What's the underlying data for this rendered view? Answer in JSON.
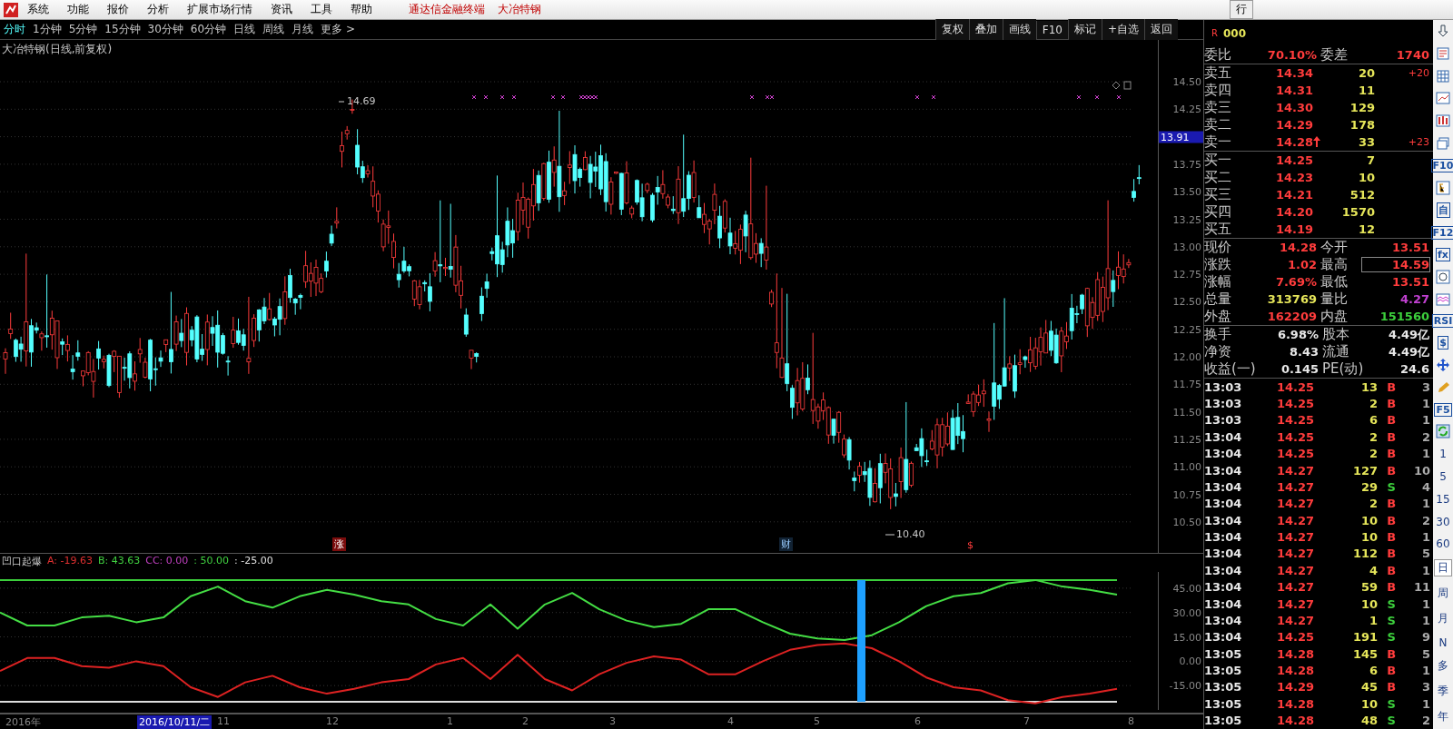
{
  "menu": [
    "系统",
    "功能",
    "报价",
    "分析",
    "扩展市场行情",
    "资讯",
    "工具",
    "帮助"
  ],
  "header_titles": [
    "通达信金融终端",
    "大冶特钢"
  ],
  "header_tab": "行",
  "period_tabs": [
    {
      "label": "分时",
      "selected": true
    },
    {
      "label": "1分钟",
      "selected": false
    },
    {
      "label": "5分钟",
      "selected": false
    },
    {
      "label": "15分钟",
      "selected": false
    },
    {
      "label": "30分钟",
      "selected": false
    },
    {
      "label": "60分钟",
      "selected": false
    },
    {
      "label": "日线",
      "selected": false
    },
    {
      "label": "周线",
      "selected": false
    },
    {
      "label": "月线",
      "selected": false
    },
    {
      "label": "更多 >",
      "selected": false
    }
  ],
  "tool_buttons": [
    "复权",
    "叠加",
    "画线",
    "F10",
    "标记",
    "+自选",
    "返回"
  ],
  "chart": {
    "title": "大冶特钢(日线,前复权)",
    "price_ticks": [
      "14.50",
      "14.25",
      "13.75",
      "13.50",
      "13.25",
      "13.00",
      "12.75",
      "12.50",
      "12.25",
      "12.00",
      "11.75",
      "11.50",
      "11.25",
      "11.00",
      "10.75",
      "10.50"
    ],
    "current_price_tag": "13.91",
    "high_label": "14.69",
    "low_label": "10.40",
    "markers": [
      {
        "text": "涨",
        "kind": "rise"
      },
      {
        "text": "财",
        "kind": "finance"
      },
      {
        "text": "$",
        "kind": "dividend"
      }
    ]
  },
  "indicator": {
    "name": "凹口起爆",
    "legend": [
      {
        "text": "A: -19.63",
        "color": "#e03030"
      },
      {
        "text": "B: 43.63",
        "color": "#40d040"
      },
      {
        "text": "CC: 0.00",
        "color": "#c040c0"
      },
      {
        "text": ": 50.00",
        "color": "#40d040"
      },
      {
        "text": ": -25.00",
        "color": "#e0e0e0"
      }
    ],
    "chart_data": {
      "type": "line",
      "ylim": [
        -30,
        55
      ],
      "grid": true,
      "yticks": [
        {
          "value": 45,
          "label": "45.00"
        },
        {
          "value": 30,
          "label": "30.00"
        },
        {
          "value": 15,
          "label": "15.00"
        },
        {
          "value": 0,
          "label": "0.00"
        },
        {
          "value": -15,
          "label": "-15.00"
        }
      ],
      "series": [
        {
          "color": "#3ccf3c",
          "values": [
            50,
            50,
            50,
            50,
            50,
            50,
            50,
            50,
            50,
            50,
            50,
            50,
            50,
            50,
            50,
            50,
            50,
            50,
            50,
            50,
            50,
            50,
            50,
            50,
            50,
            50,
            50,
            50,
            50,
            50,
            50,
            50,
            50,
            50,
            50,
            50,
            50,
            50,
            50,
            50,
            50,
            50
          ]
        },
        {
          "color": "#dddddd",
          "values": [
            -25,
            -25,
            -25,
            -25,
            -25,
            -25,
            -25,
            -25,
            -25,
            -25,
            -25,
            -25,
            -25,
            -25,
            -25,
            -25,
            -25,
            -25,
            -25,
            -25,
            -25,
            -25,
            -25,
            -25,
            -25,
            -25,
            -25,
            -25,
            -25,
            -25,
            -25,
            -25,
            -25,
            -25,
            -25,
            -25,
            -25,
            -25,
            -25,
            -25,
            -25,
            -25
          ]
        },
        {
          "color": "#44dd44",
          "values": [
            30,
            22,
            22,
            27,
            28,
            24,
            27,
            40,
            46,
            37,
            33,
            40,
            44,
            41,
            37,
            35,
            26,
            22,
            35,
            20,
            35,
            42,
            32,
            25,
            21,
            23,
            32,
            32,
            24,
            17,
            14,
            13,
            16,
            24,
            34,
            40,
            42,
            48,
            50,
            46,
            44,
            41
          ]
        },
        {
          "color": "#dd2222",
          "values": [
            -6,
            2,
            2,
            -3,
            -4,
            0,
            -3,
            -16,
            -22,
            -13,
            -9,
            -16,
            -20,
            -17,
            -13,
            -11,
            -2,
            2,
            -11,
            4,
            -11,
            -18,
            -8,
            -1,
            3,
            1,
            -8,
            -8,
            0,
            7,
            10,
            11,
            8,
            0,
            -10,
            -16,
            -18,
            -24,
            -26,
            -22,
            -20,
            -17
          ]
        }
      ]
    }
  },
  "date_axis": [
    {
      "text": "2016年",
      "selected": false
    },
    {
      "text": "2016/10/11/二",
      "selected": true
    },
    {
      "text": "11",
      "selected": false
    },
    {
      "text": "12",
      "selected": false
    },
    {
      "text": "1",
      "selected": false
    },
    {
      "text": "2",
      "selected": false
    },
    {
      "text": "3",
      "selected": false
    },
    {
      "text": "4",
      "selected": false
    },
    {
      "text": "5",
      "selected": false
    },
    {
      "text": "6",
      "selected": false
    },
    {
      "text": "7",
      "selected": false
    },
    {
      "text": "8",
      "selected": false
    }
  ],
  "quote": {
    "marker": "R",
    "code": "000",
    "ratio": {
      "label": "委比",
      "value": "70.10%",
      "label2": "委差",
      "value2": "1740"
    },
    "sells": [
      {
        "label": "卖五",
        "price": "14.34",
        "volume": "20",
        "change": "+20",
        "rising": false
      },
      {
        "label": "卖四",
        "price": "14.31",
        "volume": "11",
        "rising": false
      },
      {
        "label": "卖三",
        "price": "14.30",
        "volume": "129",
        "rising": false
      },
      {
        "label": "卖二",
        "price": "14.29",
        "volume": "178",
        "rising": false
      },
      {
        "label": "卖一",
        "price": "14.28",
        "volume": "33",
        "change": "+23",
        "rising": true
      }
    ],
    "buys": [
      {
        "label": "买一",
        "price": "14.25",
        "volume": "7",
        "rising": false
      },
      {
        "label": "买二",
        "price": "14.23",
        "volume": "10",
        "rising": false
      },
      {
        "label": "买三",
        "price": "14.21",
        "volume": "512",
        "rising": false
      },
      {
        "label": "买四",
        "price": "14.20",
        "volume": "1570",
        "rising": false
      },
      {
        "label": "买五",
        "price": "14.19",
        "volume": "12",
        "rising": false
      }
    ],
    "stats": [
      {
        "left": {
          "label": "现价",
          "value": "14.28",
          "color": "#ff3c3c",
          "boxed": false
        },
        "right": {
          "label": "今开",
          "value": "13.51",
          "color": "#ff3c3c",
          "boxed": false
        }
      },
      {
        "left": {
          "label": "涨跌",
          "value": "1.02",
          "color": "#ff3c3c",
          "boxed": false
        },
        "right": {
          "label": "最高",
          "value": "14.59",
          "color": "#ff3c3c",
          "boxed": true
        }
      },
      {
        "left": {
          "label": "涨幅",
          "value": "7.69%",
          "color": "#ff3c3c",
          "boxed": false
        },
        "right": {
          "label": "最低",
          "value": "13.51",
          "color": "#ff3c3c",
          "boxed": false
        }
      },
      {
        "left": {
          "label": "总量",
          "value": "313769",
          "color": "#e6e65a",
          "boxed": false
        },
        "right": {
          "label": "量比",
          "value": "4.27",
          "color": "#c040d0",
          "boxed": false
        }
      },
      {
        "left": {
          "label": "外盘",
          "value": "162209",
          "color": "#ff3c3c",
          "boxed": false
        },
        "right": {
          "label": "内盘",
          "value": "151560",
          "color": "#3ccf3c",
          "boxed": false
        }
      }
    ],
    "finance": [
      {
        "label": "换手",
        "value": "6.98%",
        "label2": "股本",
        "value2": "4.49亿"
      },
      {
        "label": "净资",
        "value": "8.43",
        "label2": "流通",
        "value2": "4.49亿"
      },
      {
        "label": "收益(一)",
        "value": "0.145",
        "label2": "PE(动)",
        "value2": "24.6"
      }
    ],
    "ticks": [
      {
        "time": "13:03",
        "price": "14.25",
        "volume": "13",
        "side": "B",
        "count": "3"
      },
      {
        "time": "13:03",
        "price": "14.25",
        "volume": "2",
        "side": "B",
        "count": "1"
      },
      {
        "time": "13:03",
        "price": "14.25",
        "volume": "6",
        "side": "B",
        "count": "1"
      },
      {
        "time": "13:04",
        "price": "14.25",
        "volume": "2",
        "side": "B",
        "count": "2"
      },
      {
        "time": "13:04",
        "price": "14.25",
        "volume": "2",
        "side": "B",
        "count": "1"
      },
      {
        "time": "13:04",
        "price": "14.27",
        "volume": "127",
        "side": "B",
        "count": "10"
      },
      {
        "time": "13:04",
        "price": "14.27",
        "volume": "29",
        "side": "S",
        "count": "4"
      },
      {
        "time": "13:04",
        "price": "14.27",
        "volume": "2",
        "side": "B",
        "count": "1"
      },
      {
        "time": "13:04",
        "price": "14.27",
        "volume": "10",
        "side": "B",
        "count": "2"
      },
      {
        "time": "13:04",
        "price": "14.27",
        "volume": "10",
        "side": "B",
        "count": "1"
      },
      {
        "time": "13:04",
        "price": "14.27",
        "volume": "112",
        "side": "B",
        "count": "5"
      },
      {
        "time": "13:04",
        "price": "14.27",
        "volume": "4",
        "side": "B",
        "count": "1"
      },
      {
        "time": "13:04",
        "price": "14.27",
        "volume": "59",
        "side": "B",
        "count": "11"
      },
      {
        "time": "13:04",
        "price": "14.27",
        "volume": "10",
        "side": "S",
        "count": "1"
      },
      {
        "time": "13:04",
        "price": "14.27",
        "volume": "1",
        "side": "S",
        "count": "1"
      },
      {
        "time": "13:04",
        "price": "14.25",
        "volume": "191",
        "side": "S",
        "count": "9"
      },
      {
        "time": "13:05",
        "price": "14.28",
        "volume": "145",
        "side": "B",
        "count": "5"
      },
      {
        "time": "13:05",
        "price": "14.28",
        "volume": "6",
        "side": "B",
        "count": "1"
      },
      {
        "time": "13:05",
        "price": "14.29",
        "volume": "45",
        "side": "B",
        "count": "3"
      },
      {
        "time": "13:05",
        "price": "14.28",
        "volume": "10",
        "side": "S",
        "count": "1"
      },
      {
        "time": "13:05",
        "price": "14.28",
        "volume": "48",
        "side": "S",
        "count": "2"
      }
    ]
  },
  "strip_items": [
    {
      "kind": "icon"
    },
    {
      "kind": "icon"
    },
    {
      "kind": "icon"
    },
    {
      "kind": "icon"
    },
    {
      "kind": "icon"
    },
    {
      "kind": "icon"
    },
    {
      "kind": "label",
      "text": "F10"
    },
    {
      "kind": "icon"
    },
    {
      "kind": "label",
      "text": "自"
    },
    {
      "kind": "label",
      "text": "F12"
    },
    {
      "kind": "label",
      "text": "fx"
    },
    {
      "kind": "icon"
    },
    {
      "kind": "icon"
    },
    {
      "kind": "label",
      "text": "RSI"
    },
    {
      "kind": "label",
      "text": "$"
    },
    {
      "kind": "icon"
    },
    {
      "kind": "icon"
    },
    {
      "kind": "label",
      "text": "F5"
    },
    {
      "kind": "icon"
    },
    {
      "kind": "period",
      "text": "1",
      "selected": false
    },
    {
      "kind": "period",
      "text": "5",
      "selected": false
    },
    {
      "kind": "period",
      "text": "15",
      "selected": false
    },
    {
      "kind": "period",
      "text": "30",
      "selected": false
    },
    {
      "kind": "period",
      "text": "60",
      "selected": false
    },
    {
      "kind": "period",
      "text": "日",
      "selected": true
    },
    {
      "kind": "period",
      "text": "周",
      "selected": false
    },
    {
      "kind": "period",
      "text": "月",
      "selected": false
    },
    {
      "kind": "period",
      "text": "N",
      "selected": false
    },
    {
      "kind": "period",
      "text": "多",
      "selected": false
    },
    {
      "kind": "period",
      "text": "季",
      "selected": false
    },
    {
      "kind": "period",
      "text": "年",
      "selected": false
    }
  ]
}
